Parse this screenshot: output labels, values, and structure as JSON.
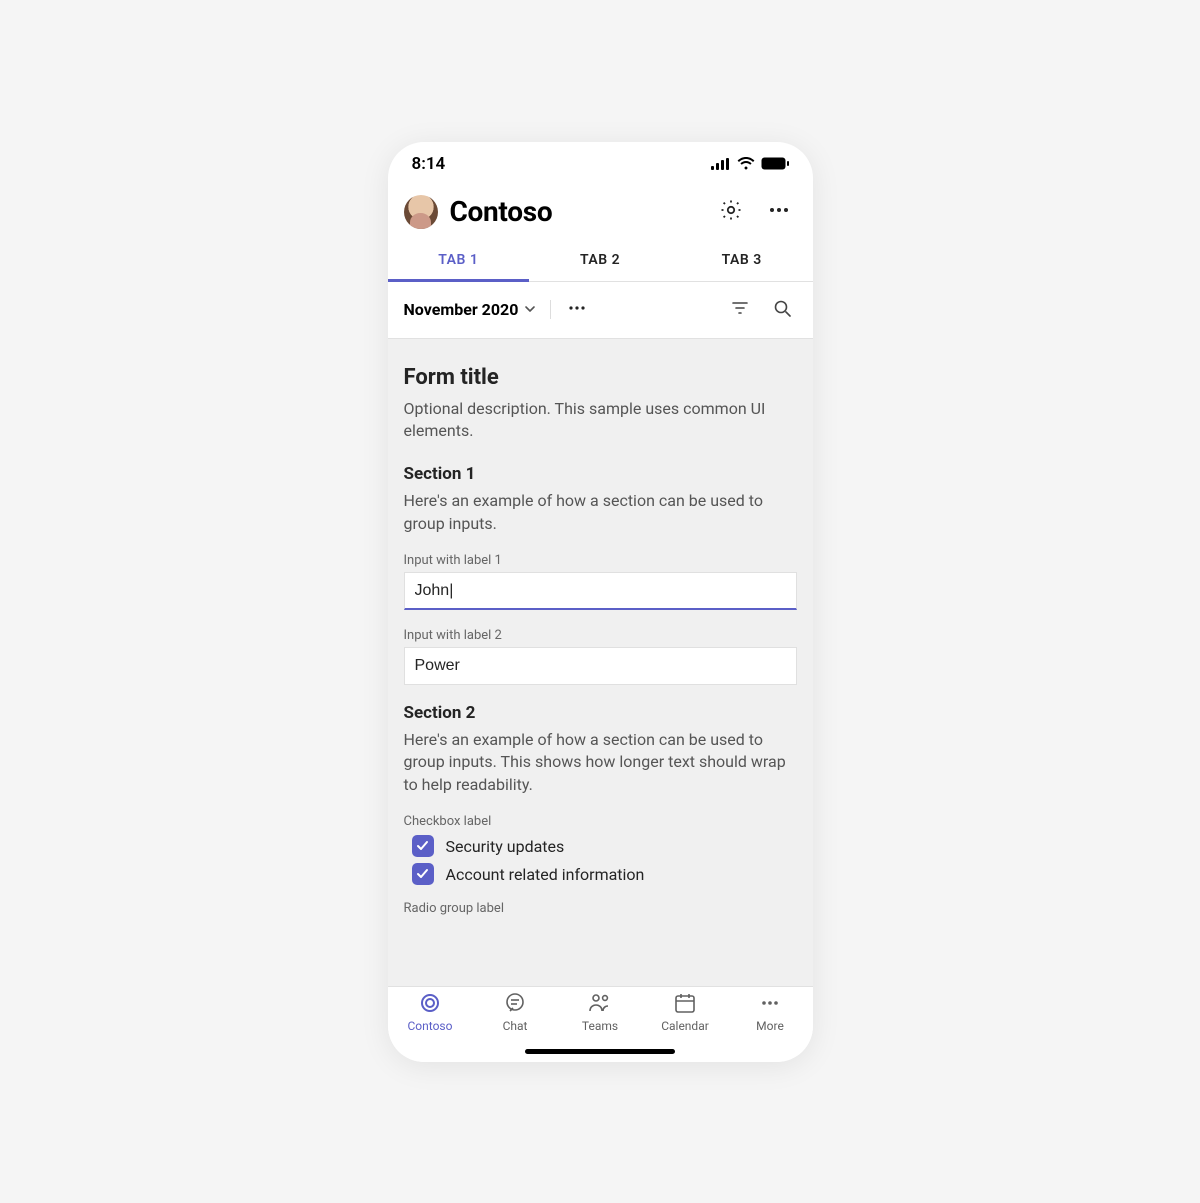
{
  "statusbar": {
    "time": "8:14"
  },
  "header": {
    "title": "Contoso"
  },
  "tabs": [
    "TAB 1",
    "TAB 2",
    "TAB 3"
  ],
  "activeTab": 0,
  "toolbar": {
    "dropdown_label": "November 2020"
  },
  "form": {
    "title": "Form title",
    "description": "Optional description. This sample uses common UI elements."
  },
  "section1": {
    "title": "Section 1",
    "description": "Here's an example of how a section can be used to group inputs.",
    "field1": {
      "label": "Input with label 1",
      "value": "John|"
    },
    "field2": {
      "label": "Input with label 2",
      "value": "Power"
    }
  },
  "section2": {
    "title": "Section 2",
    "description": "Here's an example of how a section can be used to group inputs. This shows how longer text should wrap to help readability.",
    "checkbox_group_label": "Checkbox label",
    "checkboxes": [
      {
        "label": "Security updates",
        "checked": true
      },
      {
        "label": "Account related information",
        "checked": true
      }
    ],
    "radio_group_label": "Radio group label"
  },
  "bottomnav": {
    "items": [
      {
        "label": "Contoso"
      },
      {
        "label": "Chat"
      },
      {
        "label": "Teams"
      },
      {
        "label": "Calendar"
      },
      {
        "label": "More"
      }
    ],
    "active": 0
  },
  "colors": {
    "accent": "#5B5FC7"
  }
}
